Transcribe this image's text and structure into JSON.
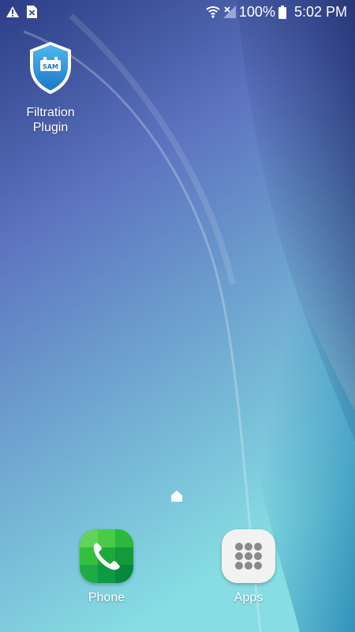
{
  "colors": {
    "wallpaper_top": "#3b4f9c",
    "wallpaper_mid": "#6f8cc9",
    "wallpaper_bottom": "#7fd6df",
    "status_text": "#ffffff",
    "phone_green": "#2fc03b",
    "apps_tile": "#f2f2f2"
  },
  "status_bar": {
    "left_icons": [
      "warning-icon",
      "sim-error-icon"
    ],
    "right_icons": [
      "wifi-icon",
      "no-signal-icon",
      "battery-icon"
    ],
    "battery": "100%",
    "time": "5:02 PM"
  },
  "desktop": {
    "apps": [
      {
        "label": "Filtration\nPlugin",
        "icon": "shield-sam-icon"
      }
    ]
  },
  "page_indicator": {
    "icon": "home-indicator-icon"
  },
  "dock": {
    "phone_label": "Phone",
    "apps_label": "Apps"
  }
}
